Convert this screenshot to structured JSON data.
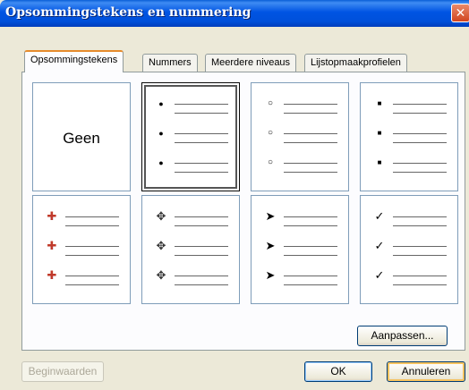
{
  "window": {
    "title": "Opsommingstekens en nummering",
    "close_glyph": "✕"
  },
  "tabs": [
    {
      "label": "Opsommingstekens",
      "active": true
    },
    {
      "label": "Nummers",
      "active": false
    },
    {
      "label": "Meerdere niveaus",
      "active": false
    },
    {
      "label": "Lijstopmaakprofielen",
      "active": false
    }
  ],
  "gallery": {
    "none_label": "Geen",
    "styles": [
      {
        "bullet": "●",
        "icon": "filled-circle-bullet-icon",
        "selected": true
      },
      {
        "bullet": "○",
        "icon": "hollow-circle-bullet-icon",
        "selected": false
      },
      {
        "bullet": "■",
        "icon": "square-bullet-icon",
        "selected": false
      },
      {
        "bullet": "✚",
        "icon": "colored-plus-bullet-icon",
        "selected": false
      },
      {
        "bullet": "✥",
        "icon": "four-diamond-bullet-icon",
        "selected": false
      },
      {
        "bullet": "➤",
        "icon": "arrowhead-bullet-icon",
        "selected": false
      },
      {
        "bullet": "✓",
        "icon": "checkmark-bullet-icon",
        "selected": false
      }
    ]
  },
  "buttons": {
    "customize": "Aanpassen...",
    "reset": "Beginwaarden",
    "ok": "OK",
    "cancel": "Annuleren"
  },
  "colors": {
    "titlebar": "#0054e3",
    "tab_active_accent": "#e68b2c",
    "dialog_bg": "#ece9d8"
  }
}
